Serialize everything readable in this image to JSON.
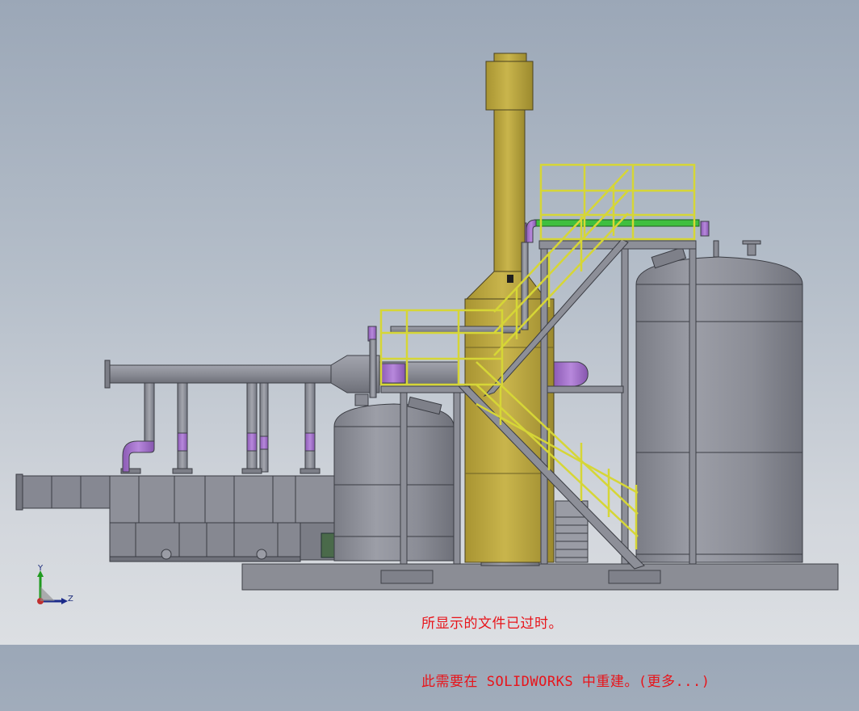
{
  "viewer": {
    "notice_line1": "所显示的文件已过时。",
    "notice_line2": "此需要在 SOLIDWORKS 中重建。(更多...)"
  },
  "triad": {
    "y_label": "Y",
    "z_label": "Z"
  },
  "colors": {
    "background_top": "#9ba7b7",
    "background_bottom": "#dcdfe3",
    "steel_gray": "#8d8f98",
    "stack_yellow": "#b9a53e",
    "railing_yellow": "#d6d636",
    "pipe_purple": "#a070c8",
    "pipe_green": "#3fbf3f",
    "notice_red": "#e8141a"
  }
}
